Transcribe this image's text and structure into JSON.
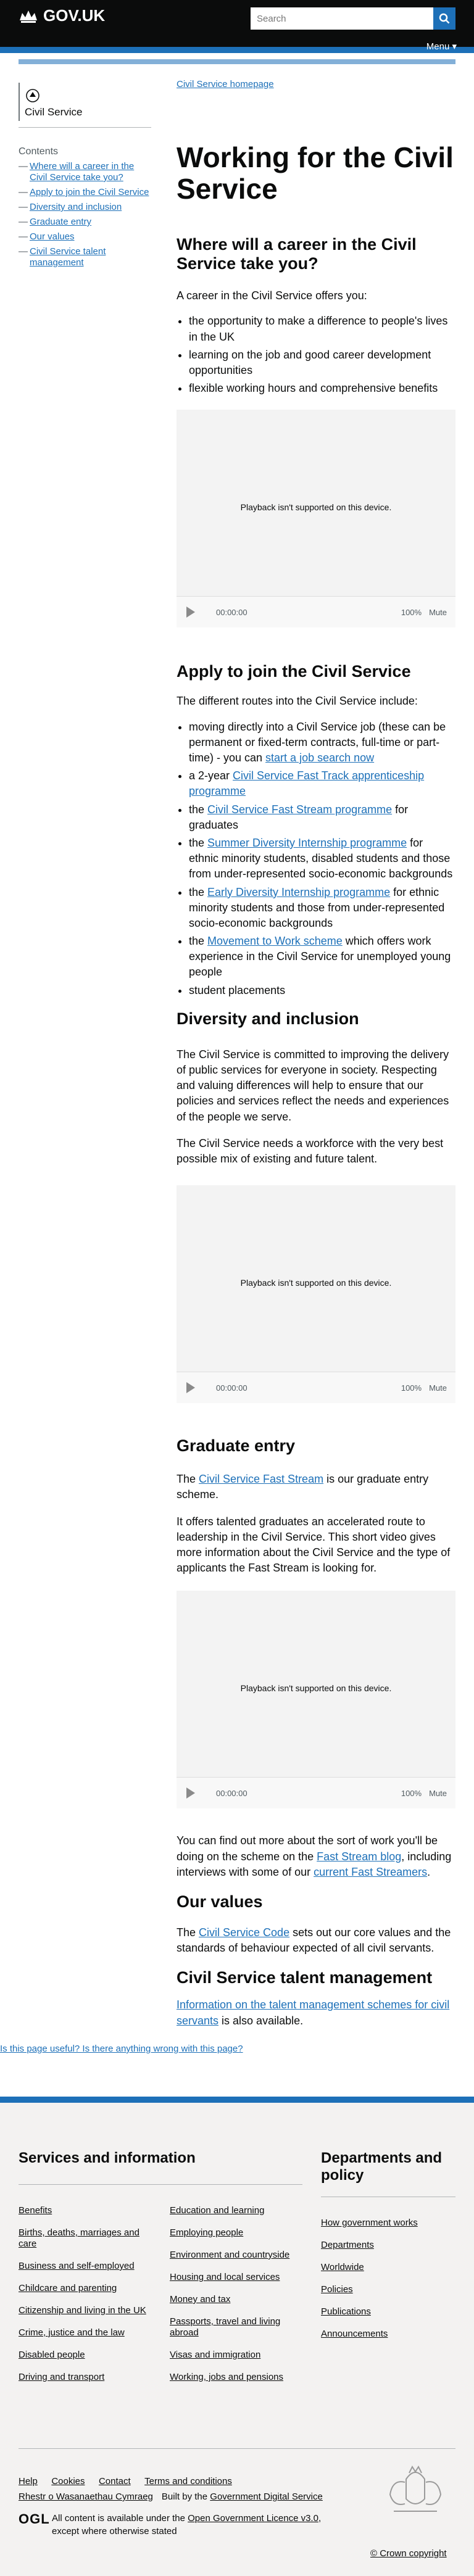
{
  "header": {
    "logo_text": "GOV.UK",
    "search_placeholder": "Search",
    "menu_label": "Menu",
    "menu_arrow": "▾"
  },
  "sidebar": {
    "org_name": "Civil Service",
    "contents_title": "Contents",
    "contents": [
      "Where will a career in the Civil Service take you?",
      "Apply to join the Civil Service",
      "Diversity and inclusion",
      "Graduate entry",
      "Our values",
      "Civil Service talent management"
    ]
  },
  "main": {
    "breadcrumb": "Civil Service homepage",
    "title": "Working for the Civil Service",
    "s1": {
      "heading": "Where will a career in the Civil Service take you?",
      "intro": "A career in the Civil Service offers you:",
      "bullets": [
        "the opportunity to make a difference to people's lives in the UK",
        "learning on the job and good career development opportunities",
        "flexible working hours and comprehensive benefits"
      ]
    },
    "video": {
      "message": "Playback isn't supported on this device.",
      "time": "00:00:00",
      "volume": "100%",
      "mute": "Mute"
    },
    "s2": {
      "heading": "Apply to join the Civil Service",
      "intro": "The different routes into the Civil Service include:",
      "b1_text": "moving directly into a Civil Service job (these can be permanent or fixed-term contracts, full-time or part-time) - you can ",
      "b1_link": "start a job search now",
      "b2_pre": "a 2-year ",
      "b2_link": "Civil Service Fast Track apprenticeship programme",
      "b3_pre": "the ",
      "b3_link": "Civil Service Fast Stream programme",
      "b3_post": " for graduates",
      "b4_pre": "the ",
      "b4_link": "Summer Diversity Internship programme",
      "b4_post": " for ethnic minority students, disabled students and those from under-represented socio-economic backgrounds",
      "b5_pre": "the ",
      "b5_link": "Early Diversity Internship programme",
      "b5_post": " for ethnic minority students and those from under-represented socio-economic backgrounds",
      "b6_pre": "the ",
      "b6_link": "Movement to Work scheme",
      "b6_post": " which offers work experience in the Civil Service for unemployed young people",
      "b7": "student placements"
    },
    "s3": {
      "heading": "Diversity and inclusion",
      "p1": "The Civil Service is committed to improving the delivery of public services for everyone in society. Respecting and valuing differences will help to ensure that our policies and services reflect the needs and experiences of the people we serve.",
      "p2": "The Civil Service needs a workforce with the very best possible mix of existing and future talent."
    },
    "s4": {
      "heading": "Graduate entry",
      "p1_pre": "The ",
      "p1_link": "Civil Service Fast Stream",
      "p1_post": " is our graduate entry scheme.",
      "p2": "It offers talented graduates an accelerated route to leadership in the Civil Service. This short video gives more information about the Civil Service and the type of applicants the Fast Stream is looking for.",
      "p3_pre": "You can find out more about the sort of work you'll be doing on the scheme on the ",
      "p3_link1": "Fast Stream blog",
      "p3_mid": ", including interviews with some of our ",
      "p3_link2": "current Fast Streamers",
      "p3_post": "."
    },
    "s5": {
      "heading": "Our values",
      "p_pre": "The ",
      "p_link": "Civil Service Code",
      "p_post": " sets out our core values and the standards of behaviour expected of all civil servants."
    },
    "s6": {
      "heading": "Civil Service talent management",
      "p_link": "Information on the talent management schemes for civil servants",
      "p_post": " is also available."
    },
    "feedback_overlap": "Is this page useful? Is there anything wrong with this page?"
  },
  "footer": {
    "services_heading": "Services and information",
    "departments_heading": "Departments and policy",
    "col1": [
      "Benefits",
      "Births, deaths, marriages and care",
      "Business and self-employed",
      "Childcare and parenting",
      "Citizenship and living in the UK",
      "Crime, justice and the law",
      "Disabled people",
      "Driving and transport"
    ],
    "col2": [
      "Education and learning",
      "Employing people",
      "Environment and countryside",
      "Housing and local services",
      "Money and tax",
      "Passports, travel and living abroad",
      "Visas and immigration",
      "Working, jobs and pensions"
    ],
    "col3": [
      "How government works",
      "Departments",
      "Worldwide",
      "Policies",
      "Publications",
      "Announcements"
    ],
    "meta_links": [
      "Help",
      "Cookies",
      "Contact",
      "Terms and conditions"
    ],
    "meta_links2": [
      "Rhestr o Wasanaethau Cymraeg"
    ],
    "built_by_pre": "Built by the ",
    "built_by_link": "Government Digital Service",
    "ogl": "OGL",
    "licence_pre": "All content is available under the ",
    "licence_link": "Open Government Licence v3.0",
    "licence_post": ", except where otherwise stated",
    "copyright": "© Crown copyright"
  }
}
